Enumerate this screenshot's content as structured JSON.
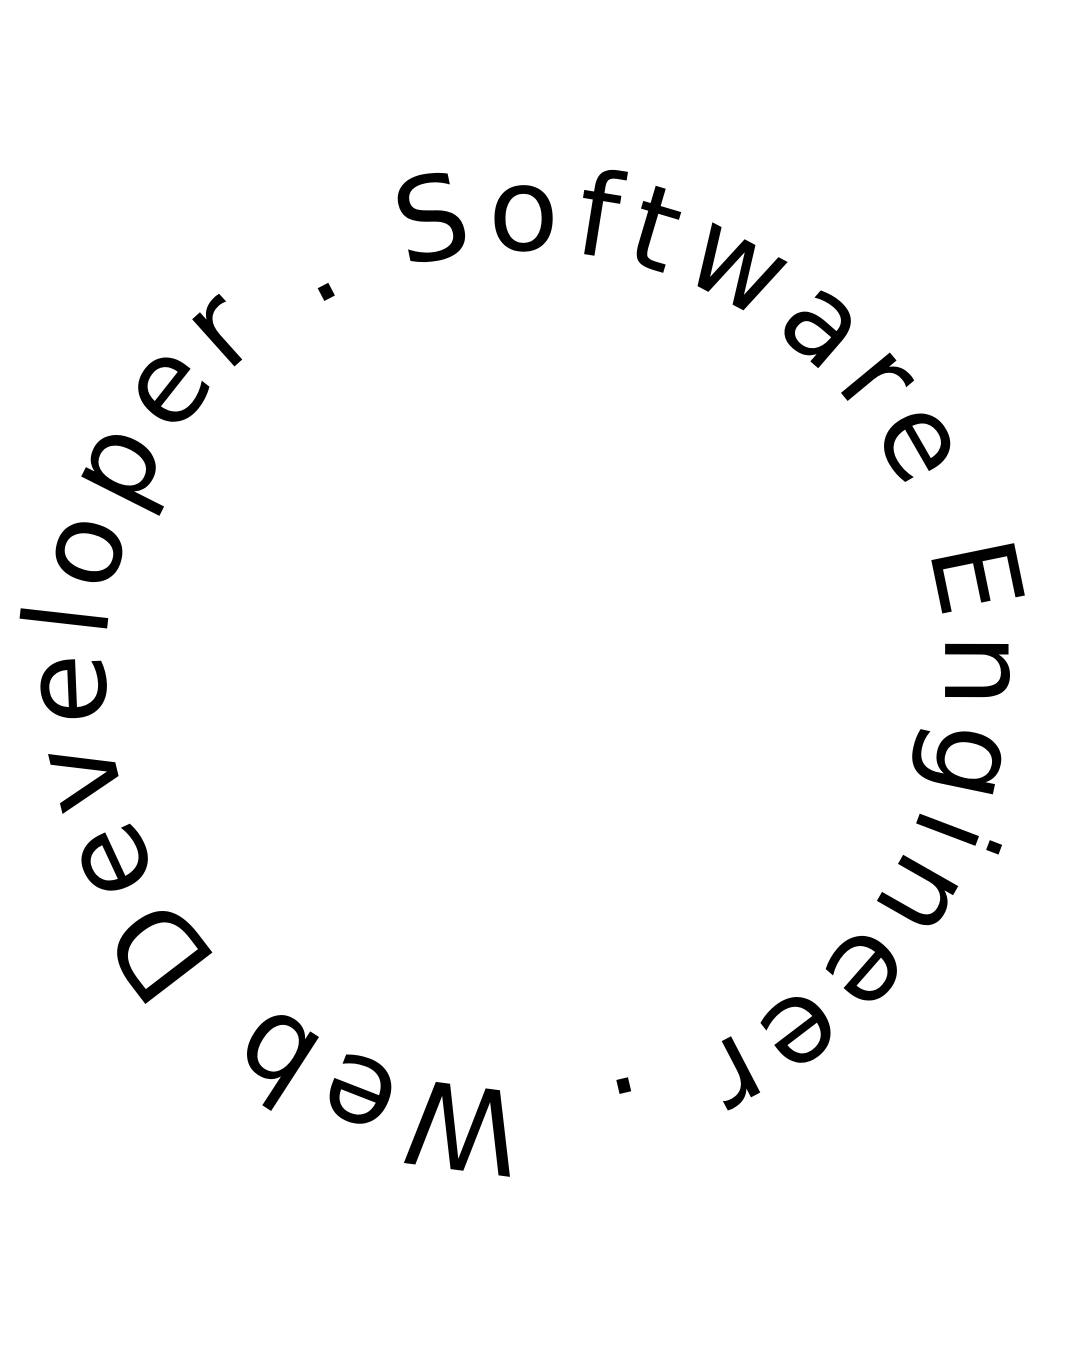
{
  "circular_text": "Web Developer . Software Engineer .",
  "text_color": "#000000",
  "background_color": "#ffffff"
}
